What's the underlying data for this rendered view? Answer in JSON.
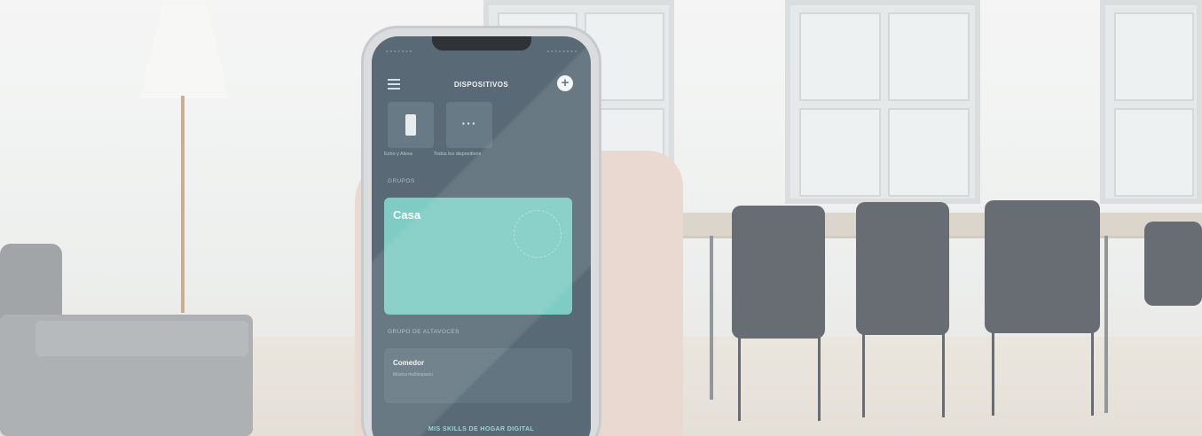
{
  "app": {
    "header_title": "DISPOSITIVOS",
    "menu_icon": "hamburger-menu-icon",
    "add_icon": "plus-circle-icon",
    "status_left": "◦ ◦ ◦ ◦ ◦ ◦ ◦",
    "status_right": "◦ ◦ ◦ ◦ ◦ ◦ ◦ ◦",
    "device_tiles": [
      {
        "label": "Echo y Alexa",
        "icon": "echo-device-icon"
      },
      {
        "label": "Todos los dispositivos",
        "icon": "more-dots-icon"
      }
    ],
    "groups_label": "GRUPOS",
    "group_card": {
      "title": "Casa",
      "color": "#74c8be"
    },
    "speaker_groups_label": "GRUPO DE ALTAVOCES",
    "speaker_card": {
      "name": "Comedor",
      "subtitle": "Música multiespacio"
    },
    "skills_link": "MIS SKILLS DE HOGAR DIGITAL"
  },
  "colors": {
    "screen_bg": "#4b5e6b",
    "accent_teal": "#74c8be"
  }
}
